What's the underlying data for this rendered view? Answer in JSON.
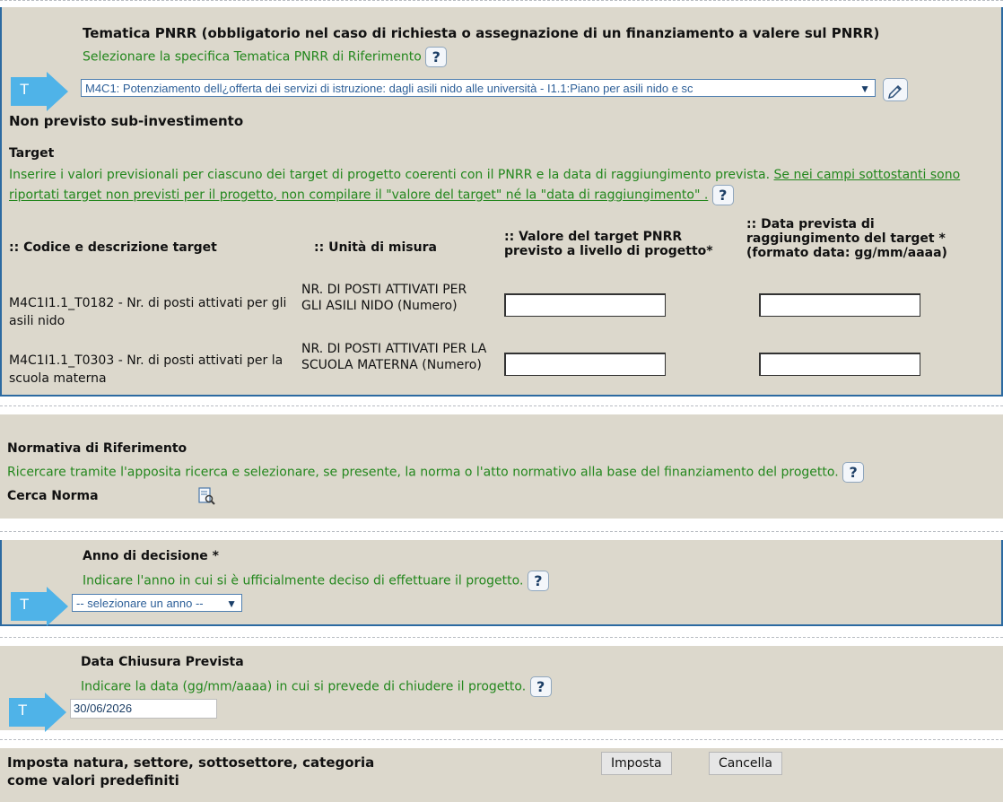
{
  "pnrr": {
    "title": "Tematica PNRR (obbligatorio nel caso di richiesta o assegnazione di un finanziamento a valere sul PNRR)",
    "subtitle": "Selezionare la specifica Tematica PNRR di Riferimento",
    "badge_letter": "T",
    "selected_value": "M4C1: Potenziamento dell¿offerta dei servizi di istruzione: dagli asili nido alle università - I1.1:Piano per asili nido e sc",
    "edit_icon": "pencil-icon"
  },
  "sub_investimento": {
    "label": "Non previsto sub-investimento"
  },
  "target": {
    "title": "Target",
    "description": "Inserire i valori previsionali per ciascuno dei target di progetto coerenti con il PNRR e la data di raggiungimento prevista.",
    "warning_link": "Se nei campi sottostanti sono riportati target non previsti per il progetto, non compilare il \"valore del target\" né la \"data di raggiungimento\" ."
  },
  "target_table": {
    "headers": {
      "codice": ":: Codice e descrizione target",
      "unita": ":: Unità di misura",
      "valore": ":: Valore del target PNRR previsto a livello di progetto*",
      "data": ":: Data prevista di raggiungimento del target * (formato data: gg/mm/aaaa)"
    },
    "rows": [
      {
        "codice": "M4C1I1.1_T0182 - Nr. di posti attivati per gli asili nido",
        "unita": "NR. DI POSTI ATTIVATI PER GLI ASILI NIDO (Numero)",
        "valore": "",
        "data": ""
      },
      {
        "codice": "M4C1I1.1_T0303 - Nr. di posti attivati per la scuola materna",
        "unita": "NR. DI POSTI ATTIVATI PER LA SCUOLA MATERNA (Numero)",
        "valore": "",
        "data": ""
      }
    ]
  },
  "normativa": {
    "title": "Normativa di Riferimento",
    "description": "Ricercare tramite l'apposita ricerca e selezionare, se presente, la norma o l'atto normativo alla base del finanziamento del progetto.",
    "search_label": "Cerca Norma",
    "search_icon": "document-search-icon"
  },
  "anno": {
    "title": "Anno di decisione *",
    "description": "Indicare l'anno in cui si è ufficialmente deciso di effettuare il progetto.",
    "badge_letter": "T",
    "selected_value": "-- selezionare un anno --"
  },
  "chiusura": {
    "title": "Data Chiusura Prevista",
    "description": "Indicare la data (gg/mm/aaaa) in cui si prevede di chiudere il progetto.",
    "badge_letter": "T",
    "value": "30/06/2026"
  },
  "imposta": {
    "label": "Imposta natura, settore, sottosettore, categoria come valori predefiniti",
    "imposta_button": "Imposta",
    "cancella_button": "Cancella"
  },
  "help_symbol": "?",
  "colors": {
    "panel": "#dcd8cc",
    "accent_blue": "#2c6aa1",
    "arrow": "#4fb3e8",
    "green_text": "#23871d"
  }
}
